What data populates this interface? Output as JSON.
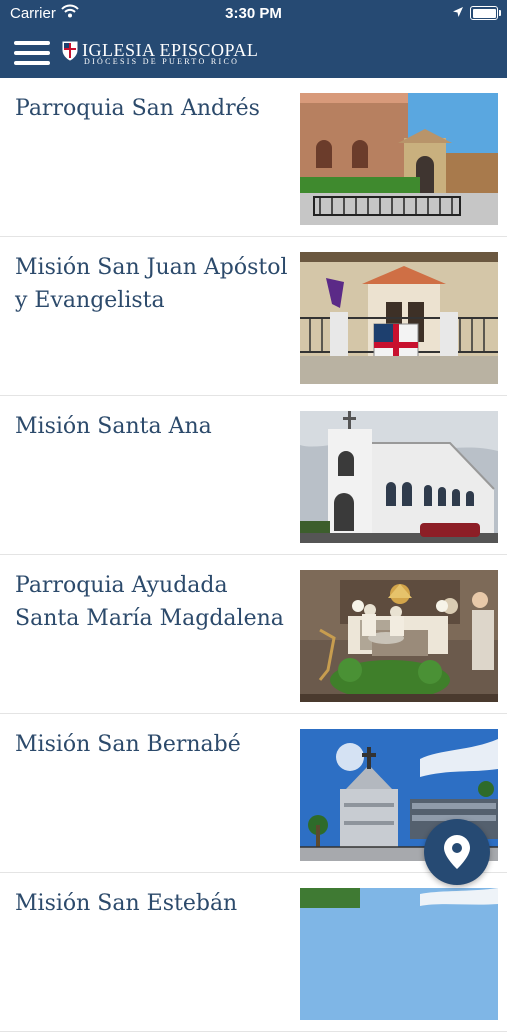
{
  "status_bar": {
    "carrier": "Carrier",
    "time": "3:30 PM"
  },
  "header": {
    "title": "IGLESIA EPISCOPAL",
    "subtitle": "DIÓCESIS DE PUERTO RICO"
  },
  "churches": [
    {
      "name": "Parroquia San Andrés"
    },
    {
      "name": "Misión San Juan Apóstol y Evangelista"
    },
    {
      "name": "Misión Santa Ana"
    },
    {
      "name": "Parroquia Ayudada Santa María Magdalena"
    },
    {
      "name": "Misión San Bernabé"
    },
    {
      "name": "Misión San Estebán"
    }
  ],
  "colors": {
    "header": "#264a73",
    "title_text": "#2c4a6b",
    "fab": "#264a73"
  },
  "icons": {
    "menu": "hamburger-icon",
    "fab": "map-pin-icon"
  }
}
